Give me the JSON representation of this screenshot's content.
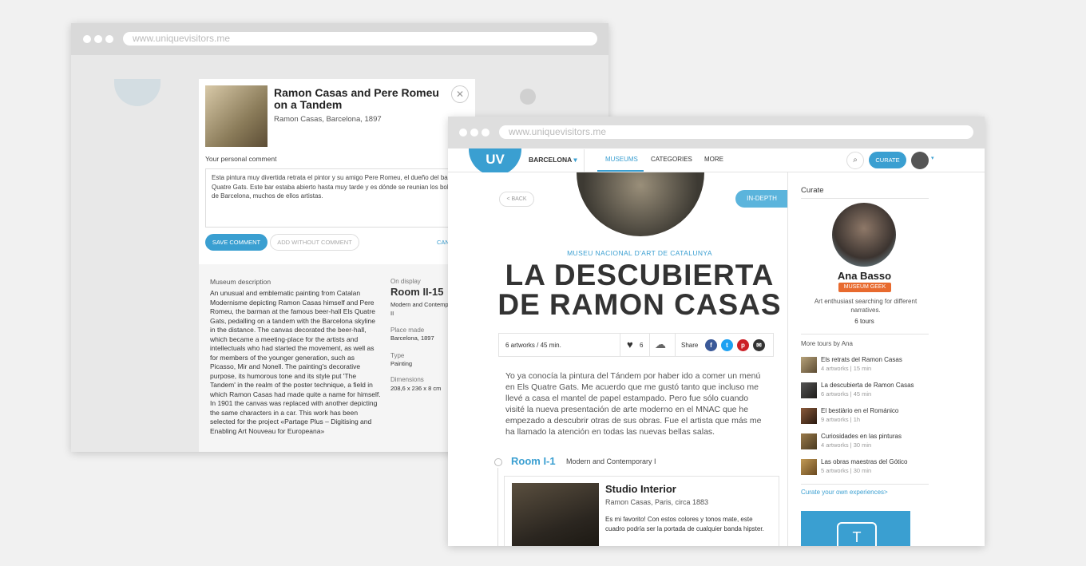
{
  "back_window": {
    "url": "www.uniquevisitors.me",
    "artwork_title": "Ramon Casas and Pere Romeu on a Tandem",
    "artwork_sub": "Ramon Casas, Barcelona, 1897",
    "comment_label": "Your personal comment",
    "comment_text": "Esta pintura muy divertida retrata el pintor y su amigo Pere Romeu, el dueño del bar Els Quatre Gats. Este bar estaba abierto hasta muy tarde y es dónde se reunian los bohemios de Barcelona, muchos de ellos artistas.",
    "save_label": "SAVE COMMENT",
    "add_label": "ADD WITHOUT COMMENT",
    "cancel_label": "CAN",
    "museum_desc_label": "Museum description",
    "museum_desc": "An unusual and emblematic painting from Catalan Modernisme depicting Ramon Casas himself and Pere Romeu, the barman at the famous beer-hall Els Quatre Gats, pedalling on a tandem with the Barcelona skyline in the distance. The canvas decorated the beer-hall, which became a meeting-place for the artists and intellectuals who had started the movement, as well as for members of the younger generation, such as Picasso, Mir and Nonell. The painting's decorative purpose, its humorous tone and its style put 'The Tandem' in the realm of the poster technique, a field in which Ramon Casas had made quite a name for himself. In 1901 the canvas was replaced with another depicting the same characters in a car. This work has been selected for the project «Partage Plus – Digitising and Enabling Art Nouveau for Europeana»",
    "on_display_label": "On display",
    "room": "Room II-15",
    "room_desc": "Modern and Contemporary II",
    "place_label": "Place made",
    "place": "Barcelona, 1897",
    "type_label": "Type",
    "type": "Painting",
    "dim_label": "Dimensions",
    "dim": "208,6 x 236 x 8 cm"
  },
  "front_window": {
    "url": "www.uniquevisitors.me",
    "logo": "UV",
    "city": "BARCELONA",
    "nav": [
      "MUSEUMS",
      "CATEGORIES",
      "MORE"
    ],
    "curate_label": "CURATE",
    "back_label": "< BACK",
    "indepth_label": "IN-DEPTH",
    "museum": "MUSEU NACIONAL D'ART DE CATALUNYA",
    "title": "LA DESCUBIERTA DE RAMON CASAS",
    "stats": "6 artworks / 45 min.",
    "likes": "6",
    "share_label": "Share",
    "intro": "Yo ya conocía la pintura del Tándem por haber ido a comer un menú en Els Quatre Gats. Me acuerdo que me gustó tanto que incluso me llevé a casa el mantel de papel estampado. Pero fue sólo cuando visité la nueva presentación de arte moderno en el MNAC que he empezado a descubrir otras de sus obras. Fue el artista que más me ha llamado la atención en todas las nuevas bellas salas.",
    "room_name": "Room I-1",
    "room_desc": "Modern and Contemporary I",
    "card_title": "Studio Interior",
    "card_sub": "Ramon Casas, Paris, circa 1883",
    "card_text": "Es mi favorito! Con estos colores y tonos mate, este cuadro podría ser la portada de cualquier banda hipster."
  },
  "sidebar": {
    "heading": "Curate",
    "name": "Ana Basso",
    "badge": "MUSEUM GEEK",
    "bio": "Art enthusiast searching for different narratives.",
    "tours": "6 tours",
    "more_heading": "More tours by Ana",
    "tour_list": [
      {
        "title": "Els retrats del Ramon Casas",
        "meta": "4 artworks | 15 min"
      },
      {
        "title": "La descubierta de Ramon Casas",
        "meta": "6 artworks | 45 min"
      },
      {
        "title": "El bestiàrio en el Románico",
        "meta": "9 artworks | 1h"
      },
      {
        "title": "Curiosidades en las pinturas",
        "meta": "4 artworks | 30 min"
      },
      {
        "title": "Las obras maestras del Gótico",
        "meta": "5 artworks | 30 min"
      }
    ],
    "curate_link": "Curate your own experiences>"
  },
  "colors": {
    "accent": "#3a9fd1",
    "badge": "#e86a2e"
  }
}
